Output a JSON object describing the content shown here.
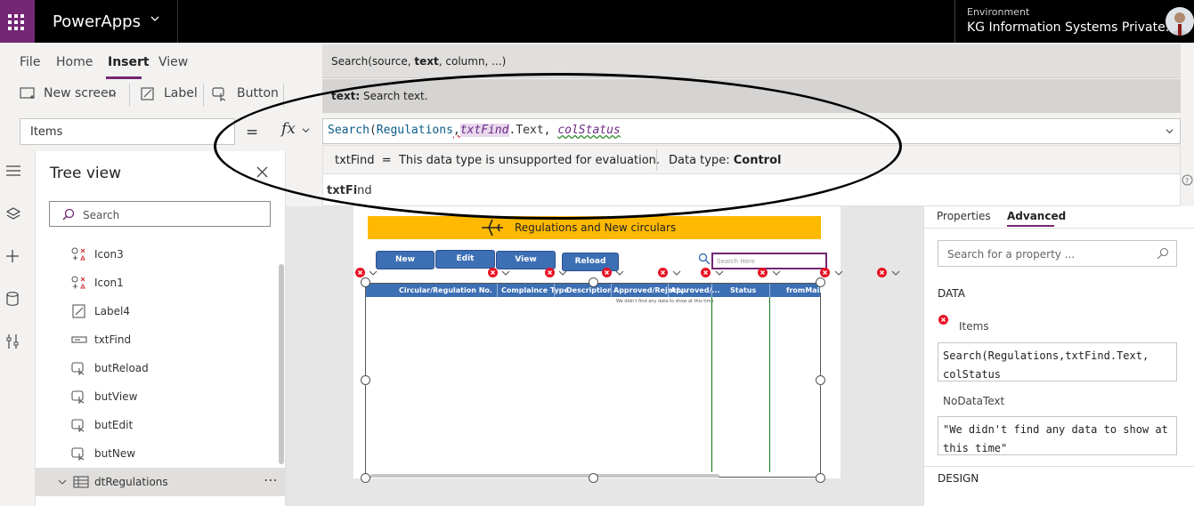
{
  "topbar": {
    "app_name": "PowerApps",
    "environment_label": "Environment",
    "environment_name": "KG Information Systems Private..."
  },
  "menu": {
    "items": [
      "File",
      "Home",
      "Insert",
      "View"
    ],
    "active": "Insert"
  },
  "ribbon": {
    "new_screen": "New screen",
    "label": "Label",
    "button": "Button"
  },
  "formula": {
    "property": "Items",
    "equals": "=",
    "fx": "fx",
    "parts": [
      "Search",
      "(",
      "Regulations",
      ",",
      "txtFi",
      "nd",
      ".Text, ",
      "colStatus"
    ]
  },
  "intellisense": {
    "signature_prefix": "Search(source, ",
    "signature_bold": "text",
    "signature_suffix": ", column, ...)",
    "param_name": "text:",
    "param_desc": " Search text.",
    "type_left": "txtFind  =  This data type is unsupported for evaluation.",
    "type_right_prefix": "Data type: ",
    "type_right_bold": "Control",
    "suggestion_bold": "txtFi",
    "suggestion_rest": "nd"
  },
  "tree": {
    "title": "Tree view",
    "search_placeholder": "Search",
    "items": [
      {
        "label": "Icon3",
        "icon": "icon-control-icon"
      },
      {
        "label": "Icon1",
        "icon": "icon-control-icon"
      },
      {
        "label": "Label4",
        "icon": "label-edit-icon"
      },
      {
        "label": "txtFind",
        "icon": "text-input-icon"
      },
      {
        "label": "butReload",
        "icon": "button-icon"
      },
      {
        "label": "butView",
        "icon": "button-icon"
      },
      {
        "label": "butEdit",
        "icon": "button-icon"
      },
      {
        "label": "butNew",
        "icon": "button-icon"
      },
      {
        "label": "dtRegulations",
        "icon": "data-table-icon"
      }
    ]
  },
  "canvas": {
    "banner": "Regulations and New circulars",
    "buttons": [
      "New",
      "Edit",
      "View",
      "Reload"
    ],
    "find_placeholder": "Search Here",
    "columns": [
      "Circular/Regulation No.",
      "Complaince Type",
      "Description",
      "Approved/Reject...",
      "Approved/...",
      "Status",
      "fromMail"
    ],
    "no_data": "We didn't find any data to show at this time"
  },
  "properties": {
    "tab_properties": "Properties",
    "tab_advanced": "Advanced",
    "search_placeholder": "Search for a property ...",
    "section_data": "DATA",
    "items_label": "Items",
    "items_value": "Search(Regulations,txtFind.Text, colStatus",
    "nodata_label": "NoDataText",
    "nodata_value": "\"We didn't find any data to show at this time\"",
    "section_design": "DESIGN"
  },
  "colors": {
    "accent": "#742774",
    "gallery_header": "#3c6fb4",
    "banner": "#ffb900",
    "error": "#e81123"
  }
}
